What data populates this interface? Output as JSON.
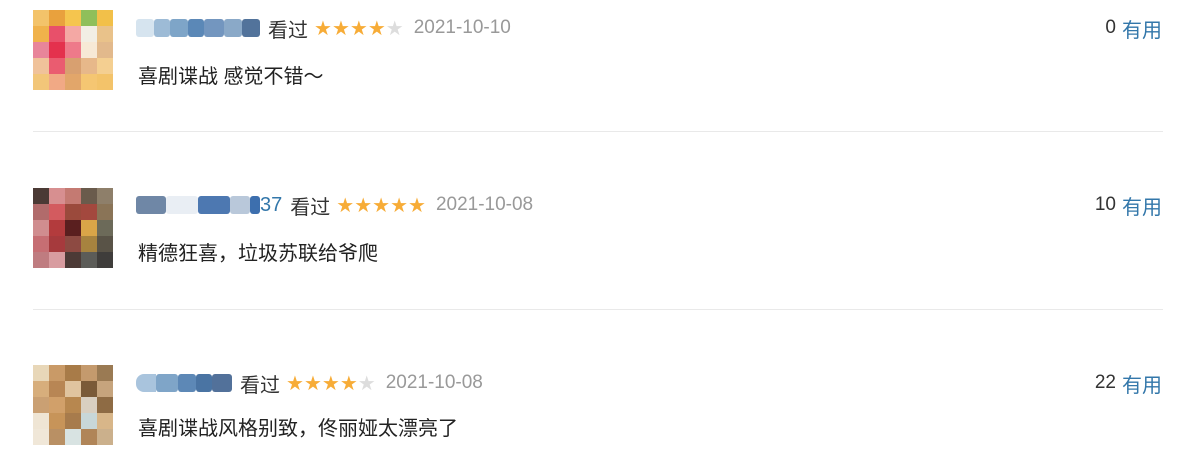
{
  "comments": [
    {
      "username_visible": "",
      "status": "看过",
      "rating": 4,
      "date": "2021-10-10",
      "votes": "0",
      "vote_label": "有用",
      "content": "喜剧谍战 感觉不错～"
    },
    {
      "username_visible": "37",
      "status": "看过",
      "rating": 5,
      "date": "2021-10-08",
      "votes": "10",
      "vote_label": "有用",
      "content": "精德狂喜，垃圾苏联给爷爬"
    },
    {
      "username_visible": "",
      "status": "看过",
      "rating": 4,
      "date": "2021-10-08",
      "votes": "22",
      "vote_label": "有用",
      "content": "喜剧谍战风格别致，佟丽娅太漂亮了"
    }
  ],
  "colors": {
    "link": "#3377aa",
    "star_on": "#f7ac37",
    "star_off": "#dddddd",
    "date": "#999999",
    "divider": "#e9e9e9"
  },
  "icons": {
    "star": "star-icon",
    "avatar": "pixelated-avatar"
  }
}
